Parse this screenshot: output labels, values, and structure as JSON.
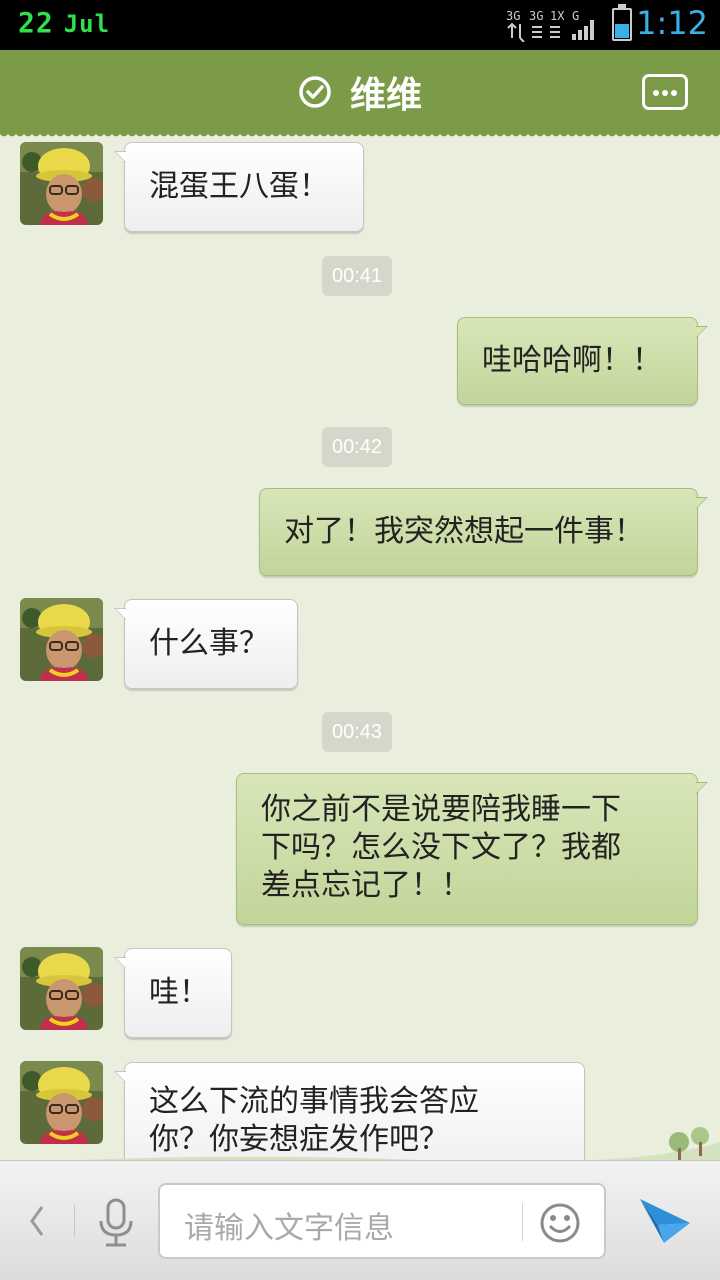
{
  "status_bar": {
    "day": "22",
    "month": "Jul",
    "time": "1:12",
    "network_label": "3G",
    "battery_percent": 50
  },
  "header": {
    "title": "维维"
  },
  "messages": [
    {
      "side": "in",
      "text": "混蛋王八蛋！"
    },
    {
      "timestamp": "00:41"
    },
    {
      "side": "out",
      "text": "哇哈哈啊！！"
    },
    {
      "timestamp": "00:42"
    },
    {
      "side": "out",
      "text": "对了！我突然想起一件事！"
    },
    {
      "side": "in",
      "text": "什么事？"
    },
    {
      "timestamp": "00:43"
    },
    {
      "side": "out",
      "lines": [
        "你之前不是说要陪我睡一下",
        "下吗？怎么没下文了？我都",
        "差点忘记了！！"
      ]
    },
    {
      "side": "in",
      "text": "哇！"
    },
    {
      "side": "in",
      "lines": [
        "这么下流的事情我会答应",
        "你？你妄想症发作吧？"
      ]
    }
  ],
  "input_bar": {
    "placeholder": "请输入文字信息"
  },
  "colors": {
    "header_green": "#7b9b48",
    "chat_background": "#e9eedd",
    "outgoing_bubble": "#c8da9f",
    "incoming_bubble": "#f4f4f4",
    "status_date": "#2ee04a",
    "status_time": "#39b1e6",
    "send_icon": "#2f8fd8"
  },
  "icons": [
    "check-circle-icon",
    "more-chat-icon",
    "back-arrow-icon",
    "microphone-icon",
    "smiley-icon",
    "send-plane-icon"
  ]
}
